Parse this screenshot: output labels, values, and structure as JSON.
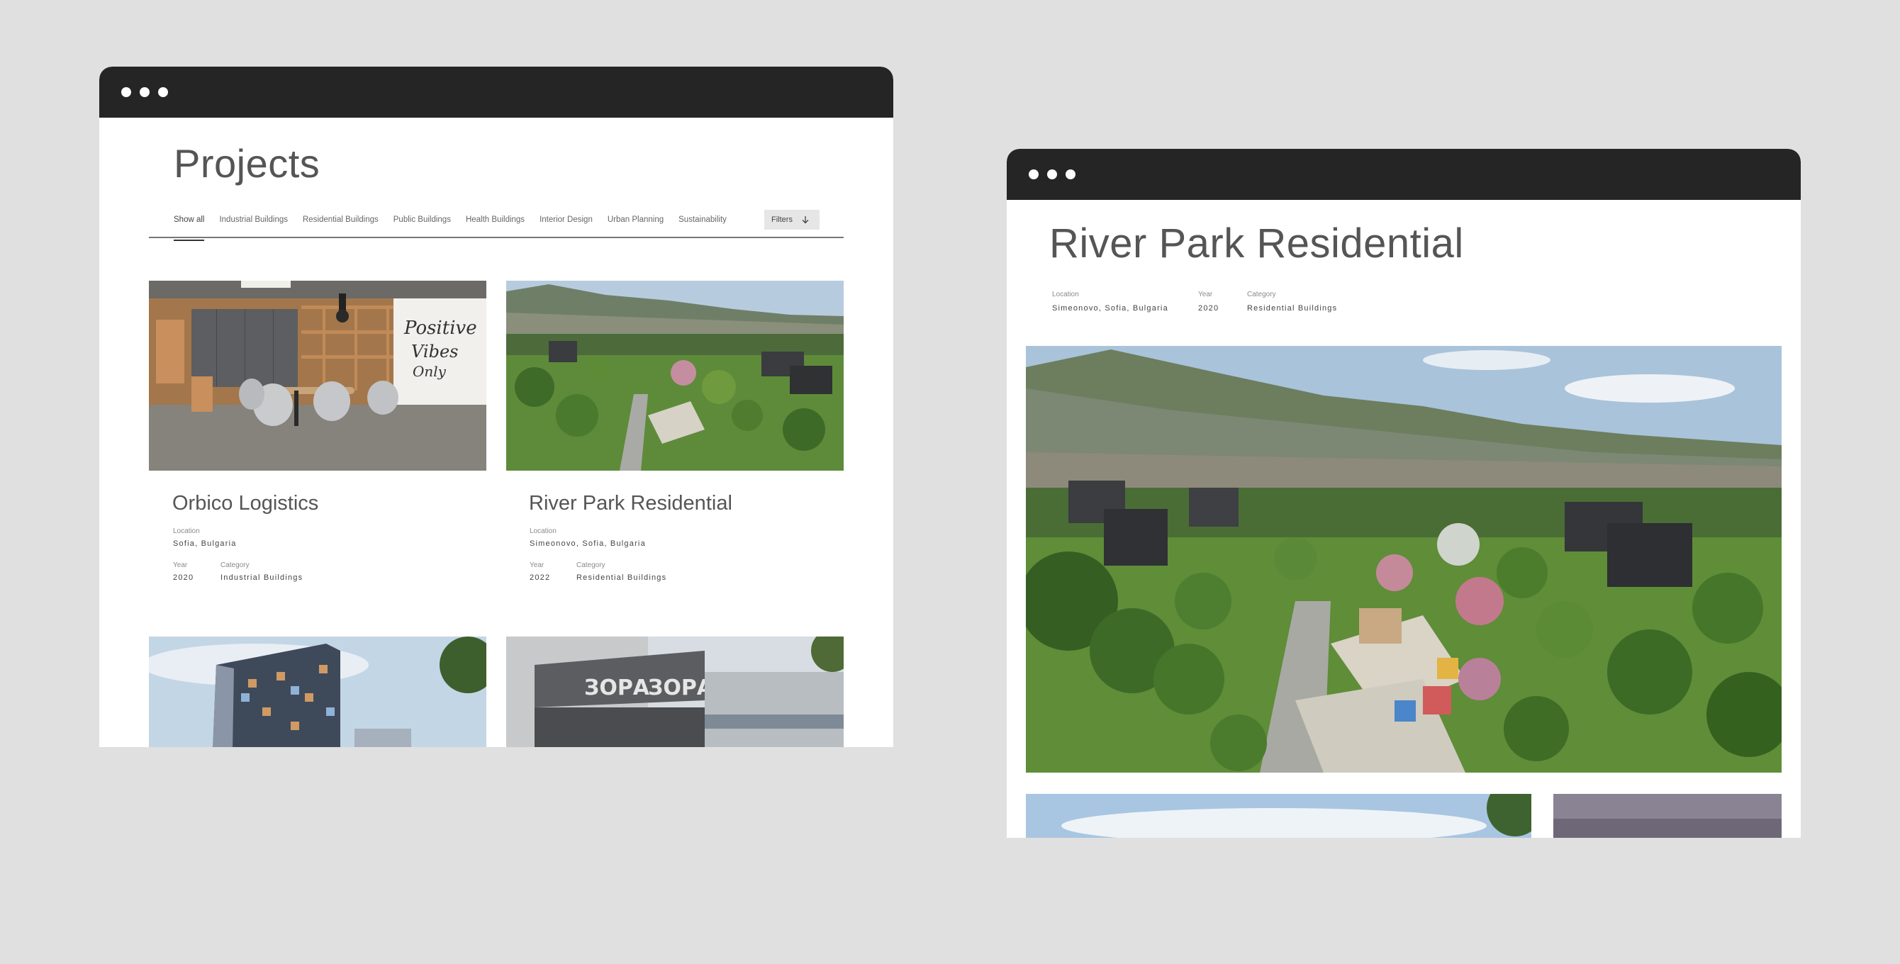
{
  "projects_window": {
    "title": "Projects",
    "filter_tabs": [
      "Show all",
      "Industrial Buildings",
      "Residential Buildings",
      "Public Buildings",
      "Health Buildings",
      "Interior Design",
      "Urban Planning",
      "Sustainability"
    ],
    "filters_label": "Filters",
    "cards": [
      {
        "title": "Orbico Logistics",
        "location_label": "Location",
        "location": "Sofia, Bulgaria",
        "year_label": "Year",
        "year": "2020",
        "category_label": "Category",
        "category": "Industrial Buildings"
      },
      {
        "title": "River Park Residential",
        "location_label": "Location",
        "location": "Simeonovo, Sofia, Bulgaria",
        "year_label": "Year",
        "year": "2022",
        "category_label": "Category",
        "category": "Residential Buildings"
      }
    ],
    "sign_text": "ЗОРА"
  },
  "detail_window": {
    "title": "River Park Residential",
    "location_label": "Location",
    "location": "Simeonovo, Sofia, Bulgaria",
    "year_label": "Year",
    "year": "2020",
    "category_label": "Category",
    "category": "Residential Buildings"
  },
  "colors": {
    "page_bg": "#e0e0e0",
    "titlebar": "#252525",
    "text": "#555555",
    "filters_bg": "#e6e6e6"
  }
}
